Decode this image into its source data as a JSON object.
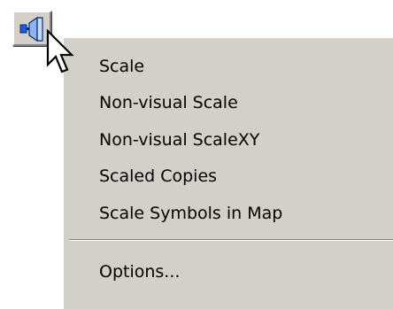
{
  "toolbar": {
    "tool_icon": "scale-tool-icon"
  },
  "menu": {
    "items": [
      {
        "label": "Scale"
      },
      {
        "label": "Non-visual Scale"
      },
      {
        "label": "Non-visual ScaleXY"
      },
      {
        "label": "Scaled Copies"
      },
      {
        "label": "Scale Symbols in Map"
      }
    ],
    "footer_items": [
      {
        "label": "Options..."
      }
    ]
  },
  "colors": {
    "menu_background": "#d4d0c8",
    "icon_accent": "#1c5cd8"
  }
}
